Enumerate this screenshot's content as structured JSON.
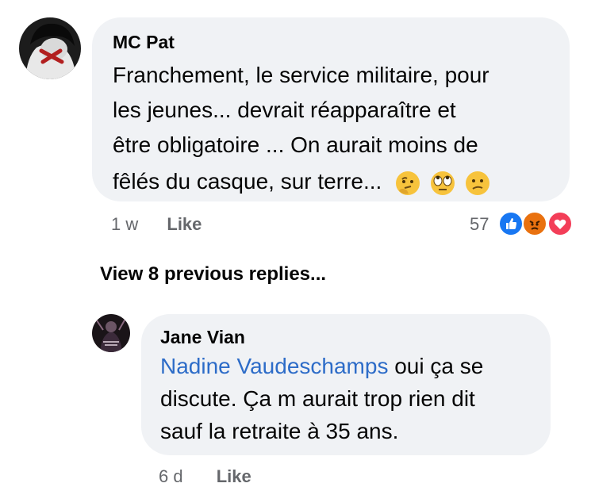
{
  "comment1": {
    "author": "MC Pat",
    "text_lines": [
      "Franchement, le service militaire, pour",
      "les jeunes... devrait réapparaître et",
      "être obligatoire ... On aurait moins de",
      "fêlés du casque, sur terre..."
    ],
    "emojis": [
      "thinking-face",
      "face-with-rolling-eyes",
      "confused-face"
    ],
    "time": "1 w",
    "like_label": "Like",
    "reaction_count": "57",
    "reactions": [
      "like",
      "angry",
      "love"
    ]
  },
  "view_previous": "View 8 previous replies...",
  "comment2": {
    "author": "Jane Vian",
    "mention": "Nadine Vaudeschamps",
    "text_after_mention": " oui ça se",
    "text_lines": [
      "discute. Ça m aurait trop rien dit",
      "sauf la retraite à 35 ans."
    ],
    "time": "6 d",
    "like_label": "Like"
  },
  "colors": {
    "bubble": "#f0f2f5",
    "mention": "#2d6cc8",
    "meta": "#65676b",
    "like_reaction": "#1877f2",
    "angry_reaction": "#e9710f",
    "love_reaction": "#f33e58"
  }
}
